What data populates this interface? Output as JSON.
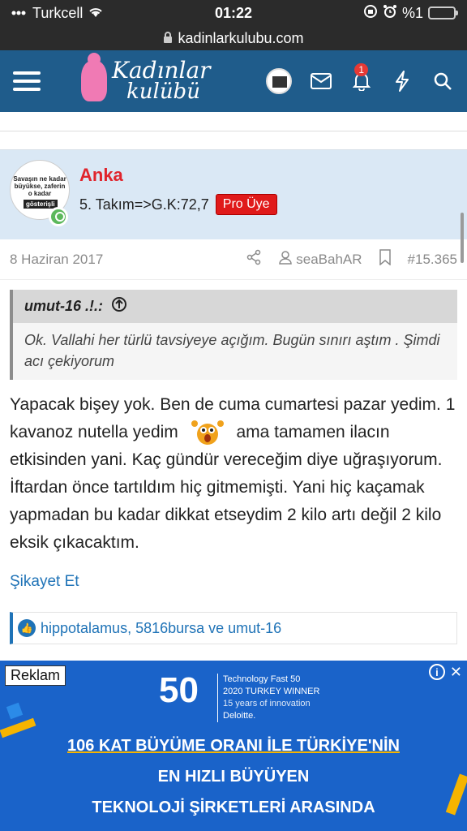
{
  "status": {
    "carrier": "Turkcell",
    "time": "01:22",
    "battery": "%1"
  },
  "browser": {
    "url": "kadinlarkulubu.com"
  },
  "site": {
    "logo_line1": "Kadınlar",
    "logo_line2": "kulübü",
    "notification_count": "1"
  },
  "post": {
    "avatar_text1": "Savaşın ne kadar büyükse, zaferin o kadar",
    "avatar_text2": "gösterişli",
    "username": "Anka",
    "user_title": "5. Takım=>G.K:72,7",
    "badge": "Pro Üye",
    "date": "8 Haziran 2017",
    "by_user": "seaBahAR",
    "post_number": "#15.365",
    "quote": {
      "author": "umut-16 .!.:",
      "text": "Ok. Vallahi her türlü tavsiyeye açığım. Bugün sınırı aştım . Şimdi acı çekiyorum"
    },
    "body_part1": "Yapacak bişey yok. Ben de cuma cumartesi pazar yedim. 1 kavanoz nutella yedim",
    "body_part2": "ama tamamen ilacın etkisinden yani. Kaç gündür vereceğim diye uğraşıyorum. İftardan önce tartıldım hiç gitmemişti. Yani hiç kaçamak yapmadan bu kadar dikkat etseydim 2 kilo artı değil 2 kilo eksik çıkacaktım.",
    "report_label": "Şikayet Et",
    "likes_text": "hippotalamus, 5816bursa ve umut-16"
  },
  "ad": {
    "label": "Reklam",
    "big_number": "50",
    "tech_line1": "Technology Fast 50",
    "tech_line2": "2020 TURKEY WINNER",
    "tech_line3": "15 years of innovation",
    "tech_line4": "Deloitte.",
    "line1": "106 KAT BÜYÜME ORANI İLE TÜRKİYE'NİN",
    "line2": "EN HIZLI BÜYÜYEN",
    "line3": "TEKNOLOJİ ŞİRKETLERİ ARASINDA"
  },
  "colors": {
    "header_bg": "#1f5c8b",
    "username": "#e0242c",
    "badge_bg": "#e01a1a",
    "link": "#1f73b7",
    "ad_bg": "#1a63c9"
  }
}
